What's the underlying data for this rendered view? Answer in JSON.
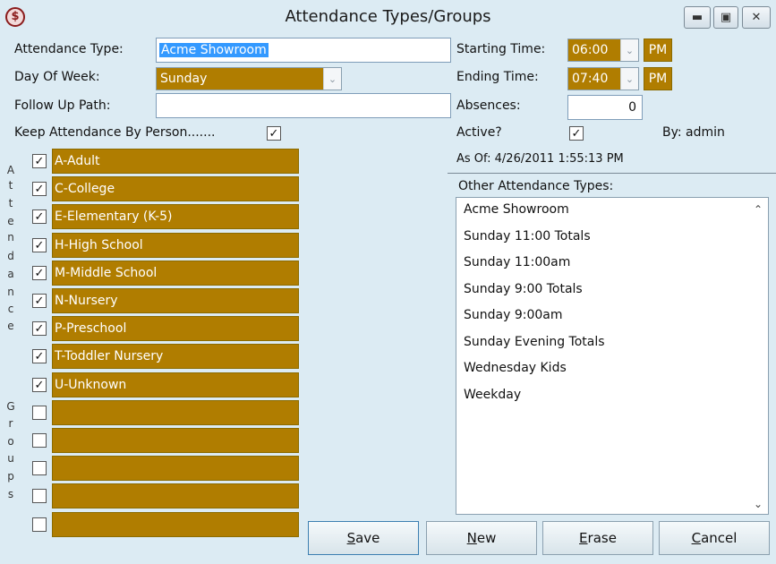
{
  "window": {
    "title": "Attendance Types/Groups",
    "app_icon": "$",
    "minimize_icon": "minimize-icon",
    "maximize_icon": "maximize-icon",
    "close_icon": "close-icon"
  },
  "form": {
    "attendance_type_label": "Attendance Type:",
    "attendance_type_value": "Acme Showroom",
    "day_of_week_label": "Day Of Week:",
    "day_of_week_value": "Sunday",
    "follow_up_path_label": "Follow Up Path:",
    "follow_up_path_value": "",
    "keep_attendance_label": "Keep Attendance By Person.......",
    "keep_attendance_checked": true,
    "starting_time_label": "Starting Time:",
    "starting_time_value": "06:00",
    "starting_time_ampm": "PM",
    "ending_time_label": "Ending Time:",
    "ending_time_value": "07:40",
    "ending_time_ampm": "PM",
    "absences_label": "Absences:",
    "absences_value": "0",
    "active_label": "Active?",
    "active_checked": true,
    "by_label": "By: admin",
    "as_of_label": "As Of:  4/26/2011 1:55:13 PM"
  },
  "vertical_label": {
    "letters": [
      "A",
      "t",
      "t",
      "e",
      "n",
      "d",
      "a",
      "n",
      "c",
      "e",
      "G",
      "r",
      "o",
      "u",
      "p",
      "s"
    ]
  },
  "groups": [
    {
      "label": "A-Adult",
      "checked": true
    },
    {
      "label": "C-College",
      "checked": true
    },
    {
      "label": "E-Elementary (K-5)",
      "checked": true
    },
    {
      "label": "H-High School",
      "checked": true
    },
    {
      "label": "M-Middle School",
      "checked": true
    },
    {
      "label": "N-Nursery",
      "checked": true
    },
    {
      "label": "P-Preschool",
      "checked": true
    },
    {
      "label": "T-Toddler Nursery",
      "checked": true
    },
    {
      "label": "U-Unknown",
      "checked": true
    },
    {
      "label": "",
      "checked": false
    },
    {
      "label": "",
      "checked": false
    },
    {
      "label": "",
      "checked": false
    },
    {
      "label": "",
      "checked": false
    },
    {
      "label": "",
      "checked": false
    }
  ],
  "other_types": {
    "title": "Other Attendance Types:",
    "items": [
      "Acme Showroom",
      "Sunday 11:00 Totals",
      "Sunday 11:00am",
      "Sunday 9:00 Totals",
      "Sunday 9:00am",
      "Sunday Evening Totals",
      "Wednesday Kids",
      "Weekday"
    ]
  },
  "buttons": {
    "save": {
      "first": "S",
      "rest": "ave"
    },
    "new": {
      "first": "N",
      "rest": "ew"
    },
    "erase": {
      "first": "E",
      "rest": "rase"
    },
    "cancel": {
      "first": "C",
      "rest": "ancel"
    }
  },
  "colors": {
    "accent_gold": "#b07d00",
    "background": "#dcebf3",
    "selection": "#3399ff"
  }
}
